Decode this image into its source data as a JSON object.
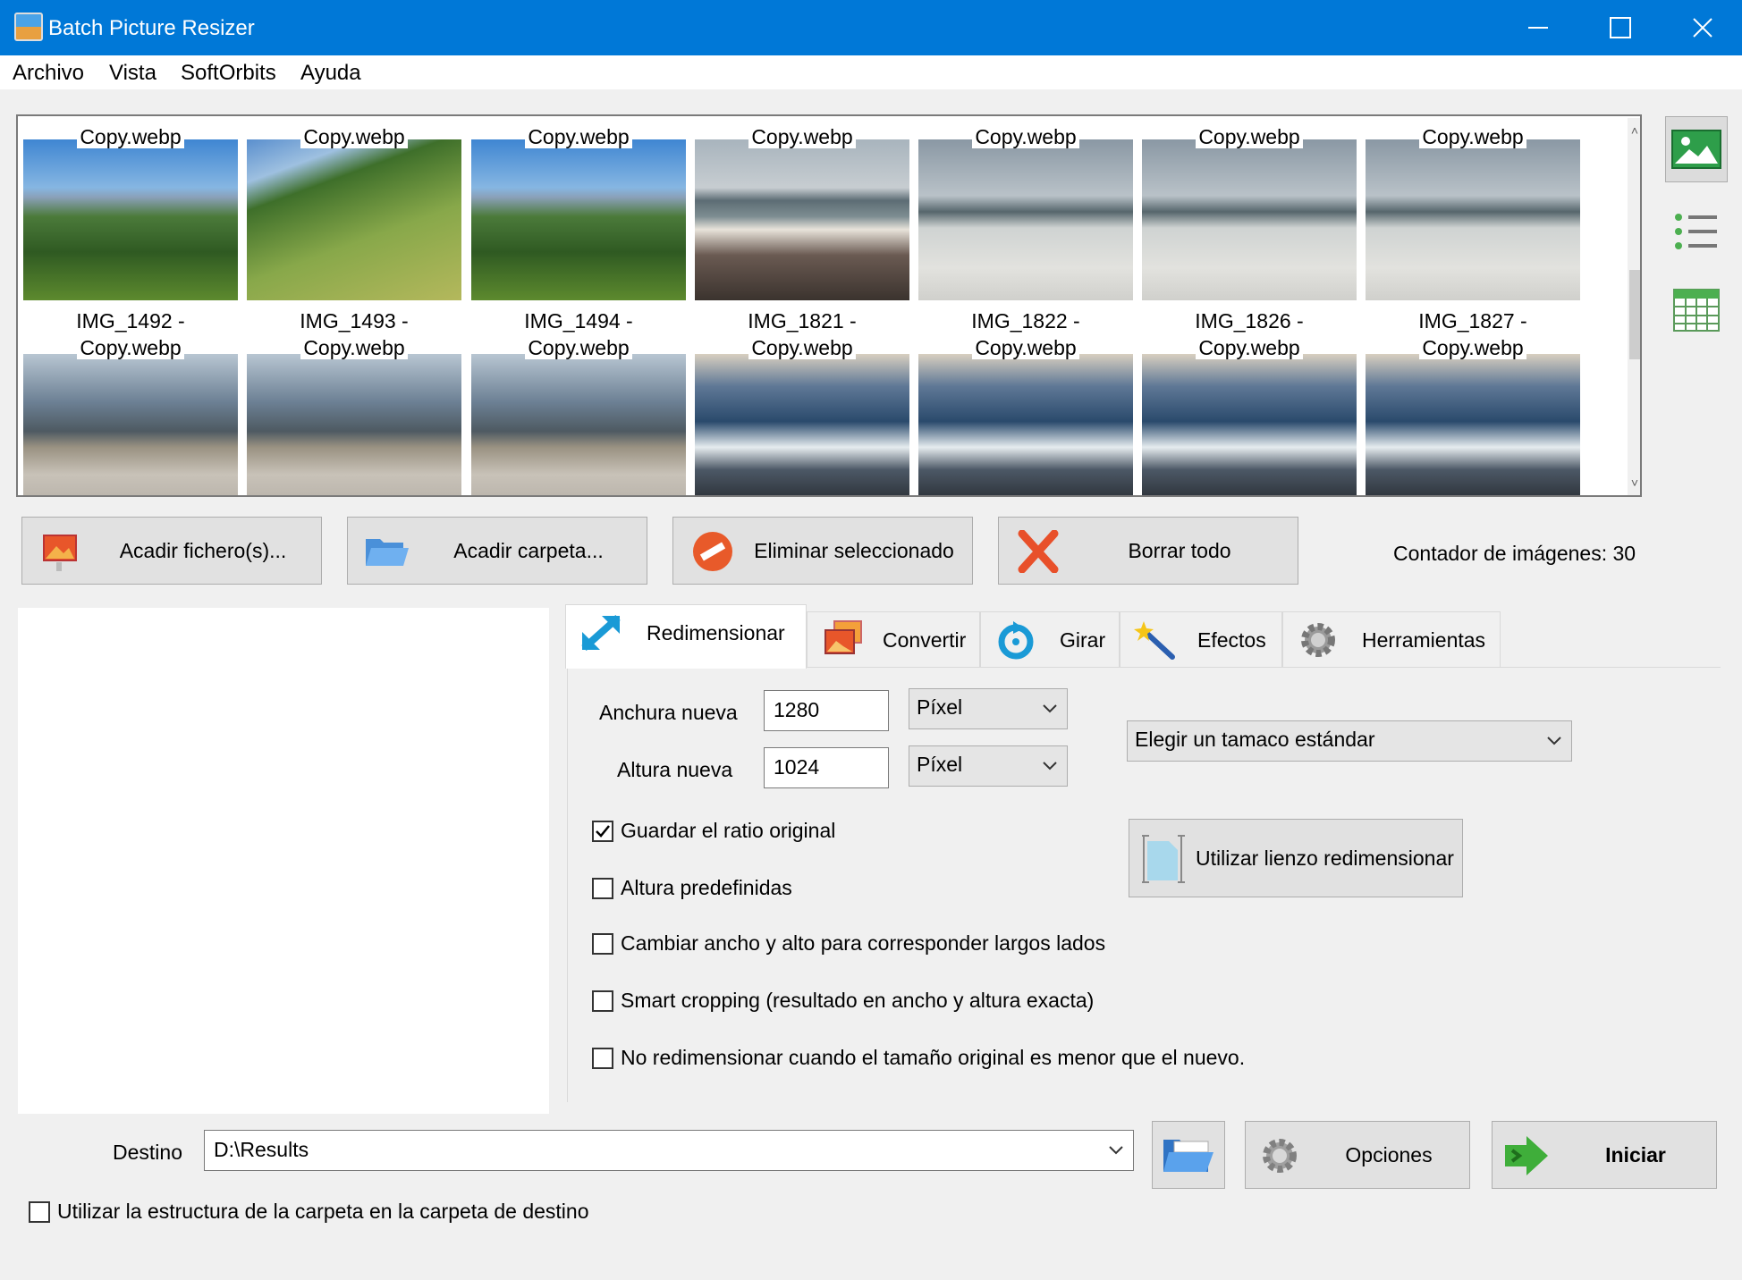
{
  "window": {
    "title": "Batch Picture Resizer"
  },
  "menu": [
    {
      "label": "Archivo"
    },
    {
      "label": "Vista"
    },
    {
      "label": "SoftOrbits"
    },
    {
      "label": "Ayuda"
    }
  ],
  "thumbnails": {
    "row1": [
      {
        "label": "Copy.webp",
        "scene": "mountain"
      },
      {
        "label": "Copy.webp",
        "scene": "hill"
      },
      {
        "label": "Copy.webp",
        "scene": "mountain"
      },
      {
        "label": "Copy.webp",
        "scene": "sea1"
      },
      {
        "label": "Copy.webp",
        "scene": "sea2"
      },
      {
        "label": "Copy.webp",
        "scene": "sea2"
      },
      {
        "label": "Copy.webp",
        "scene": "sea2"
      }
    ],
    "row2": [
      {
        "name": "IMG_1492 -",
        "label": "Copy.webp",
        "scene": "sea3"
      },
      {
        "name": "IMG_1493 -",
        "label": "Copy.webp",
        "scene": "sea3"
      },
      {
        "name": "IMG_1494 -",
        "label": "Copy.webp",
        "scene": "sea3"
      },
      {
        "name": "IMG_1821 -",
        "label": "Copy.webp",
        "scene": "rock"
      },
      {
        "name": "IMG_1822 -",
        "label": "Copy.webp",
        "scene": "rock"
      },
      {
        "name": "IMG_1826 -",
        "label": "Copy.webp",
        "scene": "rock"
      },
      {
        "name": "IMG_1827 -",
        "label": "Copy.webp",
        "scene": "rock"
      }
    ]
  },
  "actions": {
    "add_files": "Acadir fichero(s)...",
    "add_folder": "Acadir carpeta...",
    "remove_selected": "Eliminar seleccionado",
    "clear_all": "Borrar todo",
    "counter": "Contador de imágenes: 30"
  },
  "tabs": [
    {
      "label": "Redimensionar",
      "active": true
    },
    {
      "label": "Convertir",
      "active": false
    },
    {
      "label": "Girar",
      "active": false
    },
    {
      "label": "Efectos",
      "active": false
    },
    {
      "label": "Herramientas",
      "active": false
    }
  ],
  "resize": {
    "width_label": "Anchura nueva",
    "width_value": "1280",
    "width_unit": "Píxel",
    "height_label": "Altura nueva",
    "height_value": "1024",
    "height_unit": "Píxel",
    "standard_size": "Elegir un tamaco estándar",
    "canvas_button": "Utilizar lienzo redimensionar",
    "options": [
      {
        "label": "Guardar el ratio original",
        "checked": true
      },
      {
        "label": "Altura predefinidas",
        "checked": false
      },
      {
        "label": "Cambiar ancho y alto para corresponder largos lados",
        "checked": false
      },
      {
        "label": "Smart cropping (resultado en ancho y altura exacta)",
        "checked": false
      },
      {
        "label": "No redimensionar cuando el tamaño original es menor que el nuevo.",
        "checked": false
      }
    ]
  },
  "destination": {
    "label": "Destino",
    "path": "D:\\Results",
    "options_button": "Opciones",
    "start_button": "Iniciar",
    "keep_structure": "Utilizar la estructura de la carpeta en la carpeta de destino",
    "keep_structure_checked": false
  }
}
